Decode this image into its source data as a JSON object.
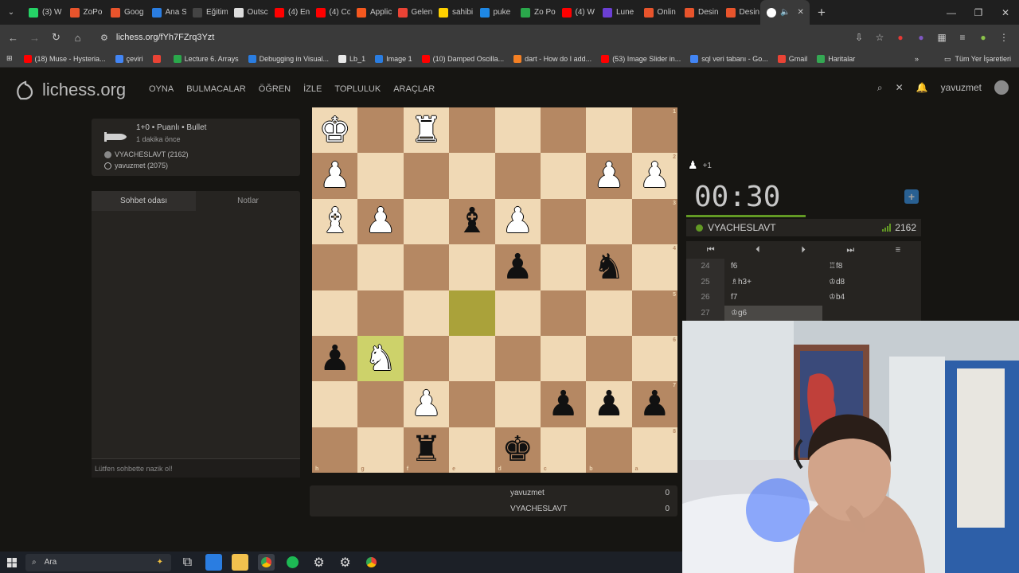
{
  "browser": {
    "tabs": [
      {
        "label": "(3) W",
        "color": "#25d366"
      },
      {
        "label": "ZoPo",
        "color": "#e8542c"
      },
      {
        "label": "Goog",
        "color": "#e8542c"
      },
      {
        "label": "Ana S",
        "color": "#2a7de1"
      },
      {
        "label": "Eğitim",
        "color": "#444444"
      },
      {
        "label": "Outsc",
        "color": "#dddddd"
      },
      {
        "label": "(4) En",
        "color": "#ff0000"
      },
      {
        "label": "(4) Co",
        "color": "#ff0000"
      },
      {
        "label": "Applic",
        "color": "#f5581f"
      },
      {
        "label": "Gelen",
        "color": "#ea4335"
      },
      {
        "label": "sahibi",
        "color": "#ffd200"
      },
      {
        "label": "puke",
        "color": "#1e88e5"
      },
      {
        "label": "Zo Po",
        "color": "#2aa84b"
      },
      {
        "label": "(4) W",
        "color": "#ff0000"
      },
      {
        "label": "Lune",
        "color": "#6b3fd4"
      },
      {
        "label": "Onlin",
        "color": "#e8542c"
      },
      {
        "label": "Desin",
        "color": "#e8542c"
      },
      {
        "label": "Desin",
        "color": "#e8542c"
      }
    ],
    "url": "lichess.org/fYh7FZrq3Yzt",
    "bookmarks": [
      {
        "label": "(18) Muse - Hysteria...",
        "color": "#ff0000"
      },
      {
        "label": "çeviri",
        "color": "#4285f4"
      },
      {
        "label": "",
        "color": "#ea4335"
      },
      {
        "label": "Lecture 6. Arrays",
        "color": "#2aa84b"
      },
      {
        "label": "Debugging in Visual...",
        "color": "#2a7de1"
      },
      {
        "label": "Lb_1",
        "color": "#e8e8e8"
      },
      {
        "label": "Image 1",
        "color": "#2a7de1"
      },
      {
        "label": "(10) Damped Oscilla...",
        "color": "#ff0000"
      },
      {
        "label": "dart - How do I add...",
        "color": "#f48024"
      },
      {
        "label": "(53) Image Slider in...",
        "color": "#ff0000"
      },
      {
        "label": "sql veri tabanı - Go...",
        "color": "#4285f4"
      },
      {
        "label": "Gmail",
        "color": "#ea4335"
      },
      {
        "label": "Haritalar",
        "color": "#34a853"
      }
    ],
    "all_bookmarks": "Tüm Yer İşaretleri"
  },
  "site": {
    "logo": "lichess.org",
    "nav": [
      "OYNA",
      "BULMACALAR",
      "ÖĞREN",
      "İZLE",
      "TOPLULUK",
      "ARAÇLAR"
    ],
    "username": "yavuzmet"
  },
  "game": {
    "type": "1+0 • Puanlı • Bullet",
    "time_ago": "1 dakika önce",
    "players": [
      "VYACHESLAVT (2162)",
      "yavuzmet (2075)"
    ]
  },
  "chat": {
    "tabs": [
      "Sohbet odası",
      "Notlar"
    ],
    "placeholder": "Lütfen sohbette nazik ol!"
  },
  "board": {
    "ranks": [
      "1",
      "2",
      "3",
      "4",
      "5",
      "6",
      "7",
      "8"
    ],
    "files": [
      "h",
      "g",
      "f",
      "e",
      "d",
      "c",
      "b",
      "a"
    ],
    "pieces": [
      [
        "wK",
        "",
        "wR",
        "",
        "",
        "",
        "",
        ""
      ],
      [
        "wP",
        "",
        "",
        "",
        "",
        "",
        "wP",
        "wP"
      ],
      [
        "wB",
        "wP",
        "",
        "bB",
        "wP",
        "",
        "",
        ""
      ],
      [
        "",
        "",
        "",
        "",
        "bP",
        "",
        "bN",
        ""
      ],
      [
        "",
        "",
        "",
        "",
        "",
        "",
        "",
        ""
      ],
      [
        "bP",
        "wN",
        "",
        "",
        "",
        "",
        "",
        ""
      ],
      [
        "",
        "",
        "wP",
        "",
        "",
        "bP",
        "bP",
        "bP"
      ],
      [
        "",
        "",
        "bR",
        "",
        "bK",
        "",
        "",
        ""
      ]
    ],
    "highlight": [
      [
        4,
        3
      ],
      [
        5,
        1
      ]
    ]
  },
  "scores": [
    {
      "name": "yavuzmet",
      "score": "0"
    },
    {
      "name": "VYACHESLAVT",
      "score": "0"
    }
  ],
  "side": {
    "captured": "+1",
    "clock": "00:30",
    "opponent": "VYACHESLAVT",
    "opponent_rating": "2162",
    "moves": [
      {
        "num": "24",
        "white": "f6",
        "black": "♖f8"
      },
      {
        "num": "25",
        "white": "♗h3+",
        "black": "♔d8"
      },
      {
        "num": "26",
        "white": "f7",
        "black": "♔b4"
      },
      {
        "num": "27",
        "white": "♔g6",
        "black": ""
      }
    ]
  },
  "taskbar": {
    "search": "Ara"
  }
}
